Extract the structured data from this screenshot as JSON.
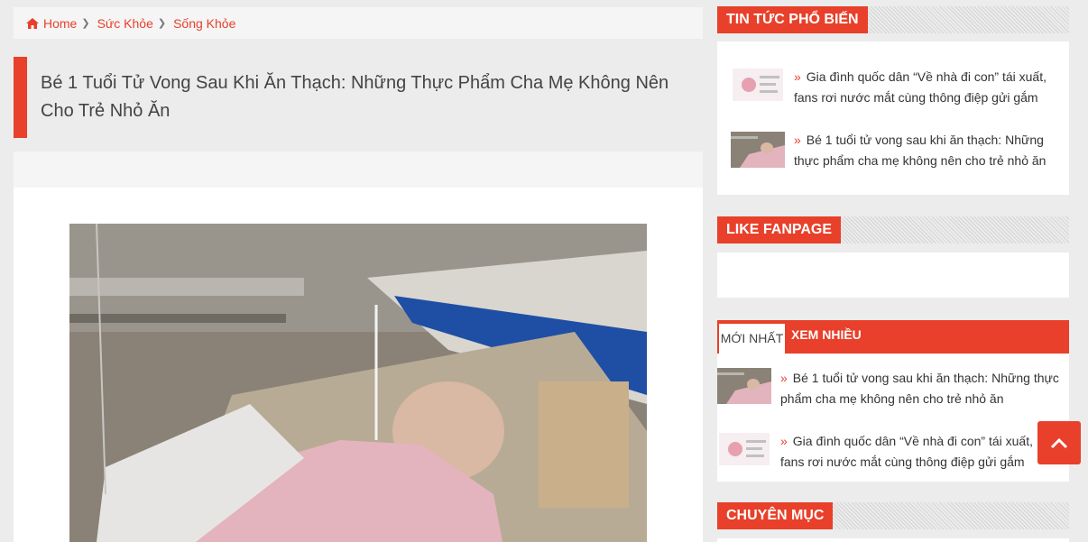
{
  "breadcrumb": [
    {
      "label": "Home"
    },
    {
      "label": "Sức Khỏe"
    },
    {
      "label": "Sống Khỏe"
    }
  ],
  "article": {
    "title": "Bé 1 Tuổi Tử Vong Sau Khi Ăn Thạch: Những Thực Phẩm Cha Mẹ Không Nên Cho Trẻ Nhỏ Ăn"
  },
  "sidebar": {
    "popular": {
      "heading": "TIN TỨC PHỔ BIẾN",
      "posts": [
        {
          "title": "Gia đình quốc dân “Về nhà đi con” tái xuất, fans rơi nước mắt cùng thông điệp gửi gắm"
        },
        {
          "title": "Bé 1 tuổi tử vong sau khi ăn thạch: Những thực phẩm cha mẹ không nên cho trẻ nhỏ ăn"
        }
      ]
    },
    "fanpage": {
      "heading": "LIKE FANPAGE"
    },
    "tabs": {
      "active": "MỚI NHẤT",
      "other": "XEM NHIỀU",
      "posts": [
        {
          "title": "Bé 1 tuổi tử vong sau khi ăn thạch: Những thực phẩm cha mẹ không nên cho trẻ nhỏ ăn"
        },
        {
          "title": "Gia đình quốc dân “Về nhà đi con” tái xuất, fans rơi nước mắt cùng thông điệp gửi gắm"
        }
      ]
    },
    "categories": {
      "heading": "CHUYÊN MỤC"
    }
  },
  "icons": {
    "home": "home-icon",
    "chevron": "chevron-right-icon",
    "arrow": "double-chevron-right-icon",
    "scroll_top": "chevron-up-icon"
  },
  "colors": {
    "accent": "#e8402a",
    "background": "#ececec",
    "panel": "#ffffff"
  }
}
